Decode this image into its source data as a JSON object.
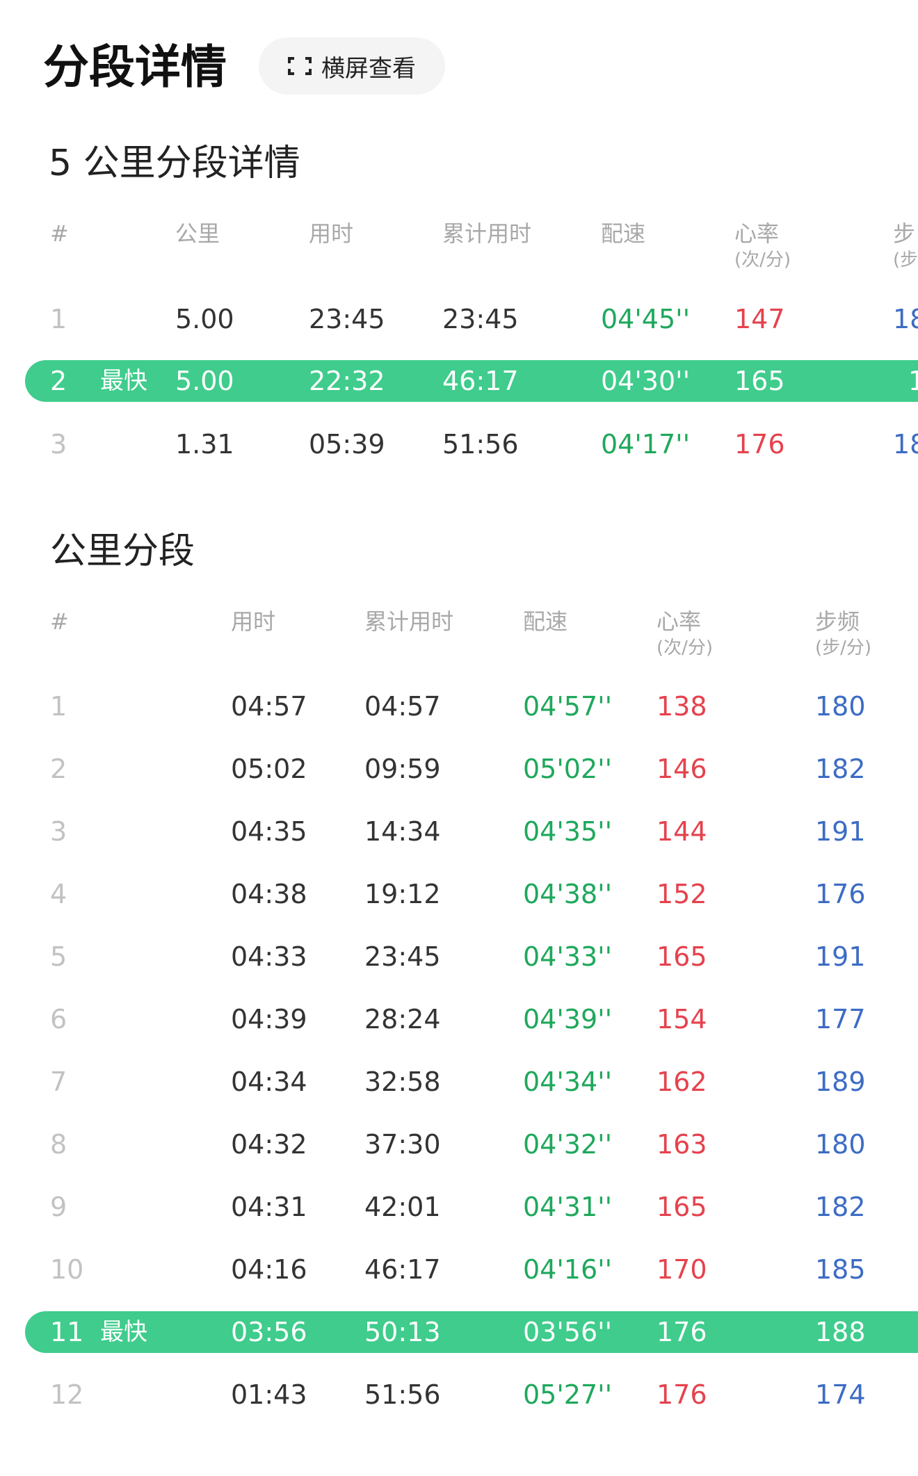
{
  "page_title": "分段详情",
  "landscape_button": {
    "label": "横屏查看",
    "icon": "fullscreen-icon"
  },
  "section1": {
    "title": "5 公里分段详情",
    "headers": {
      "index": "#",
      "km": "公里",
      "time": "用时",
      "cumulative": "累计用时",
      "pace": "配速",
      "hr": "心率",
      "hr_unit": "(次/分)",
      "cadence": "步",
      "cadence_unit": "(步"
    },
    "rows": [
      {
        "index": "1",
        "km": "5.00",
        "time": "23:45",
        "cumulative": "23:45",
        "pace": "04'45''",
        "hr": "147",
        "cadence": "18"
      },
      {
        "index": "2",
        "badge": "最快",
        "km": "5.00",
        "time": "22:32",
        "cumulative": "46:17",
        "pace": "04'30''",
        "hr": "165",
        "cadence": "1"
      },
      {
        "index": "3",
        "km": "1.31",
        "time": "05:39",
        "cumulative": "51:56",
        "pace": "04'17''",
        "hr": "176",
        "cadence": "18"
      }
    ]
  },
  "section2": {
    "title": "公里分段",
    "headers": {
      "index": "#",
      "time": "用时",
      "cumulative": "累计用时",
      "pace": "配速",
      "hr": "心率",
      "hr_unit": "(次/分)",
      "cadence": "步频",
      "cadence_unit": "(步/分)"
    },
    "rows": [
      {
        "index": "1",
        "time": "04:57",
        "cumulative": "04:57",
        "pace": "04'57''",
        "hr": "138",
        "cadence": "180"
      },
      {
        "index": "2",
        "time": "05:02",
        "cumulative": "09:59",
        "pace": "05'02''",
        "hr": "146",
        "cadence": "182"
      },
      {
        "index": "3",
        "time": "04:35",
        "cumulative": "14:34",
        "pace": "04'35''",
        "hr": "144",
        "cadence": "191"
      },
      {
        "index": "4",
        "time": "04:38",
        "cumulative": "19:12",
        "pace": "04'38''",
        "hr": "152",
        "cadence": "176"
      },
      {
        "index": "5",
        "time": "04:33",
        "cumulative": "23:45",
        "pace": "04'33''",
        "hr": "165",
        "cadence": "191"
      },
      {
        "index": "6",
        "time": "04:39",
        "cumulative": "28:24",
        "pace": "04'39''",
        "hr": "154",
        "cadence": "177"
      },
      {
        "index": "7",
        "time": "04:34",
        "cumulative": "32:58",
        "pace": "04'34''",
        "hr": "162",
        "cadence": "189"
      },
      {
        "index": "8",
        "time": "04:32",
        "cumulative": "37:30",
        "pace": "04'32''",
        "hr": "163",
        "cadence": "180"
      },
      {
        "index": "9",
        "time": "04:31",
        "cumulative": "42:01",
        "pace": "04'31''",
        "hr": "165",
        "cadence": "182"
      },
      {
        "index": "10",
        "time": "04:16",
        "cumulative": "46:17",
        "pace": "04'16''",
        "hr": "170",
        "cadence": "185"
      },
      {
        "index": "11",
        "badge": "最快",
        "time": "03:56",
        "cumulative": "50:13",
        "pace": "03'56''",
        "hr": "176",
        "cadence": "188"
      },
      {
        "index": "12",
        "time": "01:43",
        "cumulative": "51:56",
        "pace": "05'27''",
        "hr": "176",
        "cadence": "174"
      }
    ]
  },
  "colors": {
    "highlight": "#3fcc8c",
    "pace": "#1fa85c",
    "heart_rate": "#e5424d",
    "cadence": "#3c6cc4"
  }
}
